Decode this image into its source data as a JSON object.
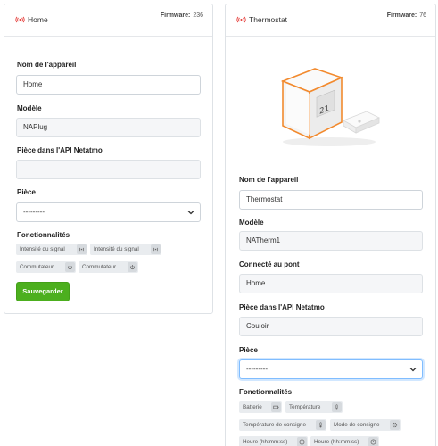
{
  "colors": {
    "accent_red": "#e53935",
    "save_green": "#4caf1e",
    "focus_blue": "#80bdff",
    "image_orange": "#f28a2e"
  },
  "left_card": {
    "title": "Home",
    "firmware_label": "Firmware:",
    "firmware_value": "236",
    "fields": {
      "name_label": "Nom de l'appareil",
      "name_value": "Home",
      "model_label": "Modèle",
      "model_value": "NAPlug",
      "room_api_label": "Pièce dans l'API Netatmo",
      "room_api_value": "",
      "room_label": "Pièce",
      "room_value": "---------"
    },
    "features_label": "Fonctionnalités",
    "features": [
      {
        "label": "Intensité du signal",
        "icon": "signal-icon"
      },
      {
        "label": "Intensité du signal",
        "icon": "signal-icon"
      },
      {
        "label": "Commutateur",
        "icon": "power-icon"
      },
      {
        "label": "Commutateur",
        "icon": "power-icon"
      }
    ],
    "save_label": "Sauvegarder"
  },
  "right_card": {
    "title": "Thermostat",
    "firmware_label": "Firmware:",
    "firmware_value": "76",
    "fields": {
      "name_label": "Nom de l'appareil",
      "name_value": "Thermostat",
      "model_label": "Modèle",
      "model_value": "NATherm1",
      "bridge_label": "Connecté au pont",
      "bridge_value": "Home",
      "room_api_label": "Pièce dans l'API Netatmo",
      "room_api_value": "Couloir",
      "room_label": "Pièce",
      "room_value": "---------"
    },
    "features_label": "Fonctionnalités",
    "features": [
      {
        "label": "Batterie",
        "icon": "battery-icon"
      },
      {
        "label": "Température",
        "icon": "thermometer-icon"
      },
      {
        "label": "Température de consigne",
        "icon": "thermometer-icon"
      },
      {
        "label": "Mode de consigne",
        "icon": "gear-icon"
      },
      {
        "label": "Heure (hh:mm:ss)",
        "icon": "clock-icon"
      },
      {
        "label": "Heure (hh:mm:ss)",
        "icon": "clock-icon"
      }
    ]
  }
}
